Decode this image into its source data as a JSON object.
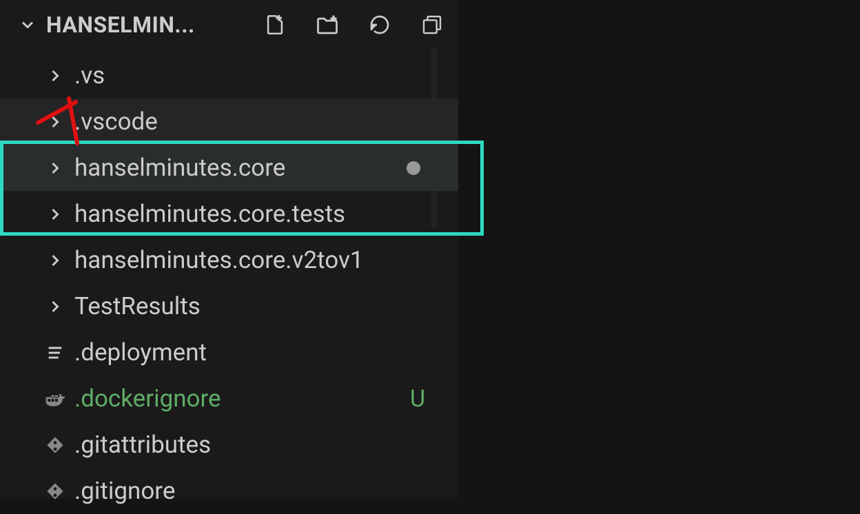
{
  "header": {
    "title": "HANSELMIN..."
  },
  "tree": {
    "items": [
      {
        "type": "folder",
        "label": ".vs",
        "expanded": false,
        "selected": false
      },
      {
        "type": "folder",
        "label": ".vscode",
        "expanded": false,
        "selected": false,
        "hovered": true
      },
      {
        "type": "folder",
        "label": "hanselminutes.core",
        "expanded": false,
        "selected": true,
        "hasDot": true
      },
      {
        "type": "folder",
        "label": "hanselminutes.core.tests",
        "expanded": false,
        "selected": false
      },
      {
        "type": "folder",
        "label": "hanselminutes.core.v2tov1",
        "expanded": false,
        "selected": false
      },
      {
        "type": "folder",
        "label": "TestResults",
        "expanded": false,
        "selected": false
      },
      {
        "type": "file",
        "label": ".deployment",
        "icon": "lines"
      },
      {
        "type": "file",
        "label": ".dockerignore",
        "icon": "docker",
        "gitStatus": "U",
        "gitNew": true
      },
      {
        "type": "file",
        "label": ".gitattributes",
        "icon": "git"
      },
      {
        "type": "file",
        "label": ".gitignore",
        "icon": "git"
      }
    ]
  }
}
